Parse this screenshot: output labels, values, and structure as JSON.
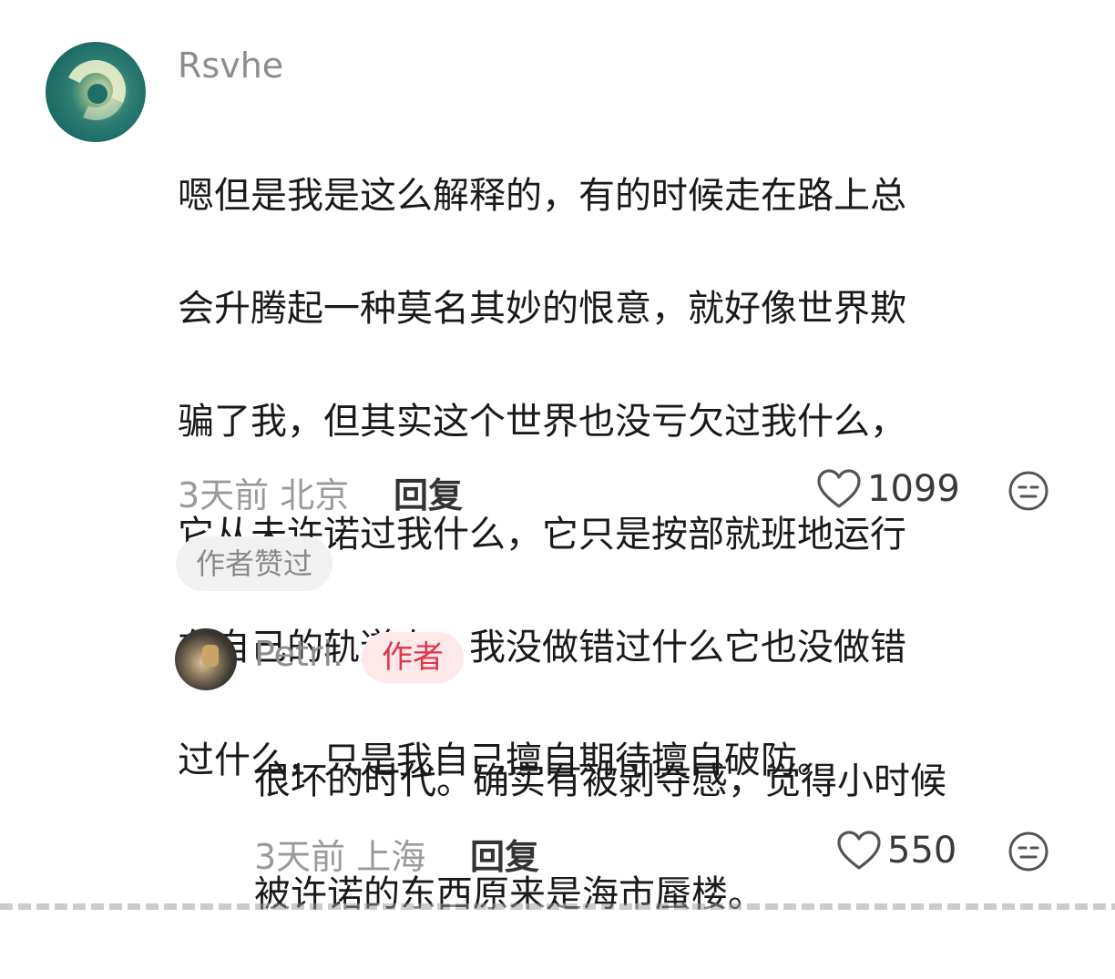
{
  "comment": {
    "username": "Rsvhe",
    "text_lines": [
      "嗯但是我是这么解释的，有的时候走在路上总",
      "会升腾起一种莫名其妙的恨意，就好像世界欺",
      "骗了我，但其实这个世界也没亏欠过我什么，",
      "它从未许诺过我什么，它只是按部就班地运行",
      "在自己的轨道上。我没做错过什么它也没做错",
      "过什么，只是我自己擅自期待擅自破防。"
    ],
    "time_location": "3天前 北京",
    "reply_label": "回复",
    "like_count": "1099",
    "author_liked_badge": "作者赞过",
    "avatar_icon": "swirl-avatar-icon",
    "like_icon": "heart-outline-icon",
    "emoji_icon": "expressionless-face-icon"
  },
  "reply": {
    "username": "Petri.",
    "author_tag": "作者",
    "text_lines": [
      "很坏的时代。确实有被剥夺感，觉得小时候",
      "被许诺的东西原来是海市蜃楼。"
    ],
    "time_location": "3天前 上海",
    "reply_label": "回复",
    "like_count": "550",
    "avatar_icon": "photo-avatar-icon",
    "like_icon": "heart-outline-icon",
    "emoji_icon": "expressionless-face-icon"
  },
  "colors": {
    "text_primary": "#1a1a1a",
    "text_secondary": "#9a9a9a",
    "author_tag_bg": "#fde8ea",
    "author_tag_text": "#e0354b",
    "badge_bg": "#f1f1f1"
  }
}
